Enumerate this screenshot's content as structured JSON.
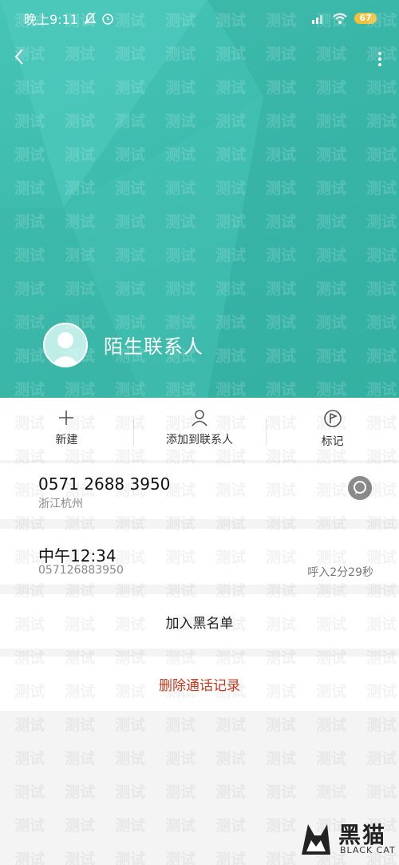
{
  "status_bar": {
    "time": "晚上9:11",
    "battery": "67"
  },
  "header": {
    "contact_name": "陌生联系人"
  },
  "actions": [
    {
      "label": "新建",
      "icon": "plus-icon"
    },
    {
      "label": "添加到联系人",
      "icon": "person-icon"
    },
    {
      "label": "标记",
      "icon": "flag-icon"
    }
  ],
  "number_card": {
    "number": "0571 2688 3950",
    "location": "浙江杭州",
    "message_icon": "message-icon"
  },
  "call_log": {
    "time": "中午12:34",
    "number": "057126883950",
    "duration": "呼入2分29秒"
  },
  "block_label": "加入黑名单",
  "delete_label": "删除通话记录",
  "watermark_text": "测试",
  "logo": {
    "zh": "黑猫",
    "en": "BLACK CAT"
  },
  "colors": {
    "header_teal": "#3dbcae",
    "delete_red": "#c63a1f",
    "battery_yellow": "#f2c13a"
  }
}
